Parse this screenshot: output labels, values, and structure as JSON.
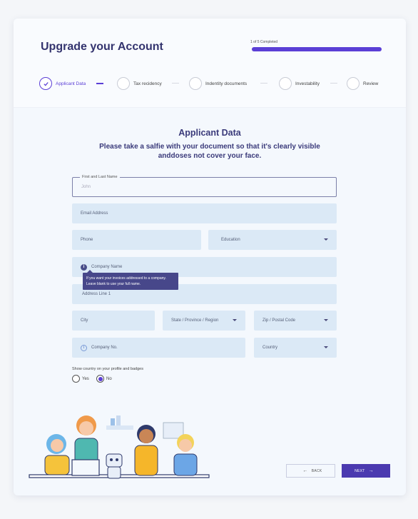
{
  "header": {
    "title": "Upgrade your Account",
    "progress_label": "1 of 5 Completed",
    "progress_fraction": 1.0
  },
  "steps": [
    {
      "label": "Applicant Data",
      "active": true
    },
    {
      "label": "Tax recidency",
      "active": false
    },
    {
      "label": "Indentity documents",
      "active": false
    },
    {
      "label": "Investability",
      "active": false
    },
    {
      "label": "Review",
      "active": false
    }
  ],
  "form": {
    "title": "Applicant Data",
    "subtitle": "Please take a salfie with your document so that it's clearly visible anddoses not cover your face.",
    "name": {
      "legend": "First and Last Name",
      "value": "John"
    },
    "email": {
      "placeholder": "Email Address"
    },
    "phone": {
      "placeholder": "Phone"
    },
    "education": {
      "placeholder": "Education"
    },
    "company_name": {
      "placeholder": "Company Name"
    },
    "tooltip": "If you want your invoices addressed to a company. Leave blank to use your full name.",
    "address1": {
      "placeholder": "Address Line 1"
    },
    "city": {
      "placeholder": "City"
    },
    "state": {
      "placeholder": "State / Province / Region"
    },
    "zip": {
      "placeholder": "Zip / Postal Code"
    },
    "company_no": {
      "placeholder": "Company No."
    },
    "country": {
      "placeholder": "Country"
    },
    "show_country_question": "Show country on your profile and badges",
    "radio_yes": "Yes",
    "radio_no": "No",
    "radio_selected": "No"
  },
  "buttons": {
    "back": "BACK",
    "next": "NEXT"
  },
  "colors": {
    "accent": "#5b3fd6",
    "field_bg": "#dbe9f6",
    "title": "#33336e"
  }
}
